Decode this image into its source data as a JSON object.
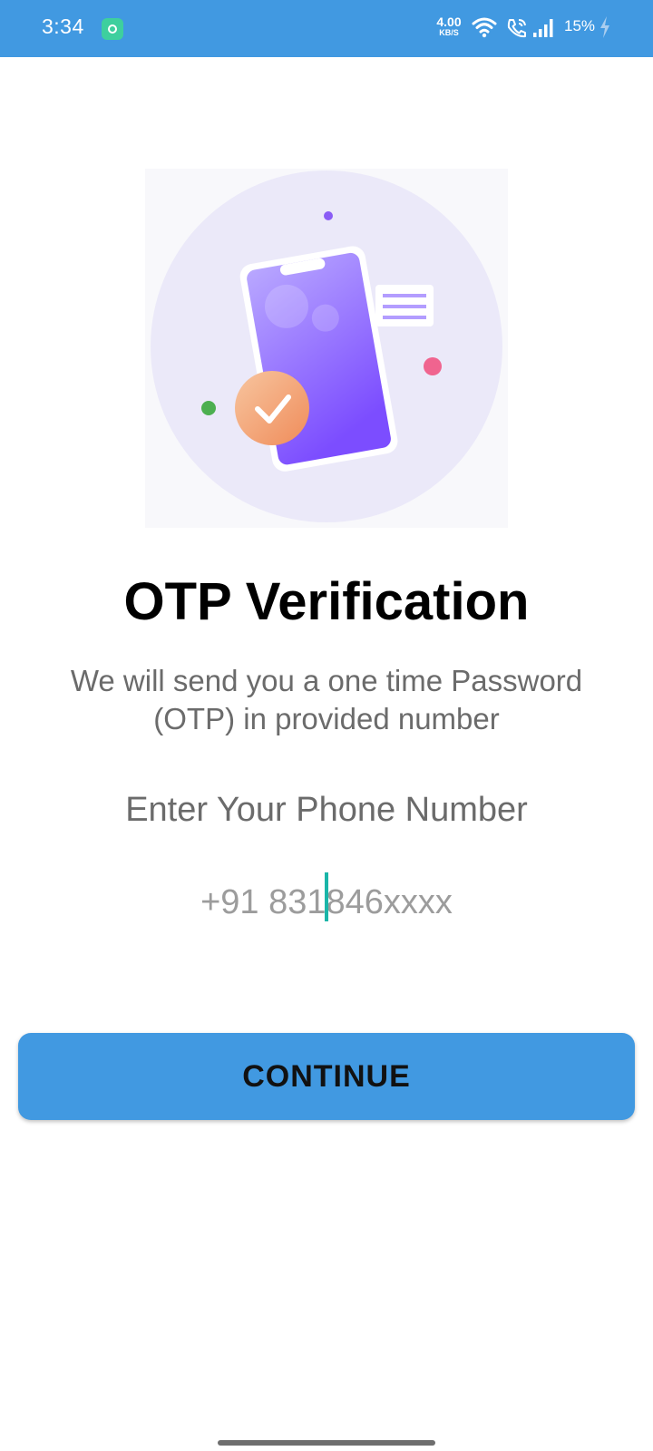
{
  "status_bar": {
    "time": "3:34",
    "net_speed_value": "4.00",
    "net_speed_unit": "KB/S",
    "battery": "15%"
  },
  "colors": {
    "accent": "#4199e1",
    "cursor": "#1ab5a8",
    "illustration_purple": "#7c4dff",
    "check_orange": "#f5a36b"
  },
  "icons": [
    "app-notification-icon",
    "wifi-icon",
    "wifi-call-icon",
    "signal-icon",
    "charging-bolt-icon",
    "otp-phone-illustration"
  ],
  "main": {
    "title": "OTP Verification",
    "subtitle": "We will send you a one time Password (OTP) in provided number",
    "phone_label": "Enter Your Phone Number",
    "phone_value": "+91 831846xxxx",
    "continue_label": "CONTINUE"
  }
}
